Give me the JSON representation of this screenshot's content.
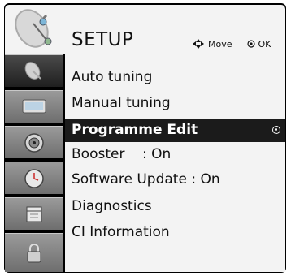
{
  "header": {
    "title": "SETUP",
    "move_label": "Move",
    "ok_label": "OK"
  },
  "menu": {
    "items": [
      {
        "label": "Auto tuning"
      },
      {
        "label": "Manual tuning"
      },
      {
        "label": "Programme Edit"
      },
      {
        "label": "Booster",
        "value": ": On"
      },
      {
        "label": "Software Update : On"
      },
      {
        "label": "Diagnostics"
      },
      {
        "label": "CI Information"
      }
    ]
  },
  "sidebar": {
    "items": [
      {
        "icon": "satellite-dish-icon"
      },
      {
        "icon": "tv-screen-icon"
      },
      {
        "icon": "speaker-icon"
      },
      {
        "icon": "clock-icon"
      },
      {
        "icon": "calendar-icon"
      },
      {
        "icon": "lock-icon"
      }
    ]
  },
  "colors": {
    "frame": "#000000",
    "panel": "#f3f3f3",
    "selected_bg": "#1b1b1b"
  }
}
